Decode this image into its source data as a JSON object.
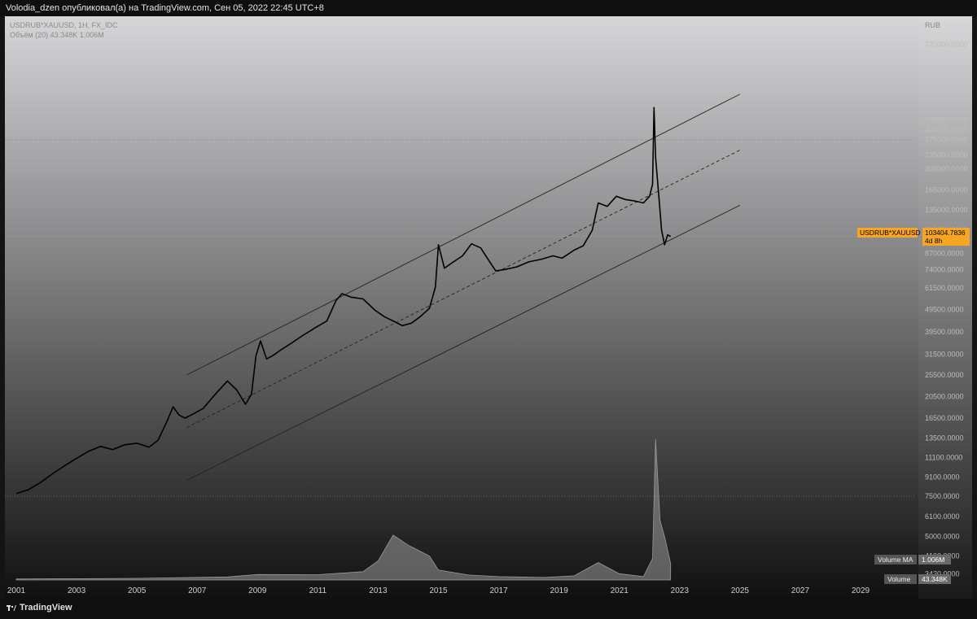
{
  "header": {
    "publisher_line": "Volodia_dzen опубликовал(а) на TradingView.com, Сен 05, 2022 22:45 UTC+8"
  },
  "footer": {
    "brand": "TradingView"
  },
  "legend": {
    "symbol_line": "USDRUB*XAUUSD, 1Н, FX_IDC",
    "volume_line": "Объём (20)  43.348K  1.006M"
  },
  "price_axis": {
    "currency": "RUB"
  },
  "price_tag": {
    "symbol": "USDRUB*XAUUSD",
    "price": "103404.7836",
    "countdown": "4d 8h"
  },
  "volume_tags": {
    "ma_label": "Volume MA",
    "ma_value": "1.006M",
    "vol_label": "Volume",
    "vol_value": "43.348K"
  },
  "colors": {
    "background_top": "#d6d6d9",
    "background_bottom": "#101010",
    "price_line": "#000000",
    "price_tag": "#f6a623",
    "volume": "#9a9a9a",
    "channel": "#222222"
  },
  "chart_data": {
    "type": "line",
    "title": "USDRUB*XAUUSD, 1Н, FX_IDC",
    "y_scale": "log",
    "ylim": [
      6000,
      800000
    ],
    "xlim": [
      2000.85,
      2030.3
    ],
    "y_ticks": [
      720000,
      335000,
      305000,
      275000,
      235000,
      205000,
      165000,
      135000,
      110000,
      87000,
      74000,
      61500,
      49500,
      39500,
      31500,
      25500,
      20500,
      16500,
      13500,
      11100,
      9100,
      7500,
      6100,
      5000,
      4100,
      3420
    ],
    "x_ticks": [
      "2001",
      "2003",
      "2005",
      "2007",
      "2009",
      "2011",
      "2013",
      "2015",
      "2017",
      "2019",
      "2021",
      "2023",
      "2025",
      "2027",
      "2029"
    ],
    "series": [
      {
        "name": "USDRUB*XAUUSD",
        "x": [
          2001.0,
          2001.4,
          2001.8,
          2002.2,
          2002.6,
          2003.0,
          2003.4,
          2003.8,
          2004.2,
          2004.6,
          2005.0,
          2005.4,
          2005.7,
          2006.0,
          2006.2,
          2006.4,
          2006.6,
          2006.9,
          2007.2,
          2007.6,
          2008.0,
          2008.3,
          2008.6,
          2008.8,
          2008.95,
          2009.1,
          2009.3,
          2009.5,
          2009.8,
          2010.1,
          2010.5,
          2010.9,
          2011.3,
          2011.6,
          2011.8,
          2012.1,
          2012.5,
          2012.9,
          2013.2,
          2013.5,
          2013.8,
          2014.1,
          2014.4,
          2014.7,
          2014.9,
          2015.0,
          2015.2,
          2015.5,
          2015.8,
          2016.1,
          2016.4,
          2016.7,
          2016.9,
          2017.2,
          2017.6,
          2018.0,
          2018.4,
          2018.8,
          2019.1,
          2019.5,
          2019.8,
          2020.1,
          2020.3,
          2020.6,
          2020.9,
          2021.2,
          2021.5,
          2021.8,
          2022.0,
          2022.1,
          2022.15,
          2022.2,
          2022.3,
          2022.4,
          2022.5,
          2022.6,
          2022.7
        ],
        "y": [
          7700,
          8000,
          8600,
          9400,
          10200,
          11000,
          11800,
          12400,
          12000,
          12600,
          12800,
          12300,
          13200,
          16000,
          18500,
          17000,
          16500,
          17300,
          18200,
          21000,
          24000,
          22000,
          19000,
          21000,
          31000,
          36000,
          30000,
          31000,
          33000,
          35000,
          38000,
          41000,
          44000,
          54000,
          58000,
          56000,
          55000,
          49000,
          46000,
          44000,
          42000,
          43000,
          46000,
          50000,
          62000,
          95000,
          75000,
          80000,
          85000,
          96000,
          92000,
          80000,
          73000,
          74000,
          76000,
          80000,
          82000,
          85000,
          83000,
          90000,
          94000,
          110000,
          145000,
          140000,
          155000,
          150000,
          148000,
          145000,
          155000,
          175000,
          380000,
          230000,
          160000,
          110000,
          95000,
          105000,
          103400
        ]
      },
      {
        "name": "Volume",
        "x": [
          2001.0,
          2005.0,
          2008.0,
          2009.0,
          2011.0,
          2012.5,
          2013.0,
          2013.5,
          2014.0,
          2014.7,
          2015.0,
          2016.0,
          2017.0,
          2018.5,
          2019.5,
          2020.3,
          2021.0,
          2021.8,
          2022.1,
          2022.2,
          2022.35,
          2022.5,
          2022.7
        ],
        "y": [
          60000,
          100000,
          180000,
          330000,
          320000,
          500000,
          1150000,
          2700000,
          2100000,
          1450000,
          600000,
          300000,
          200000,
          150000,
          250000,
          1050000,
          380000,
          200000,
          1300000,
          8500000,
          3600000,
          2600000,
          1006000
        ]
      }
    ],
    "annotations": [
      {
        "type": "parallel_channel",
        "x": [
          2006.65,
          2022.15
        ],
        "upper_y": [
          25500,
          280000
        ],
        "middle_y": [
          15000,
          160000
        ],
        "lower_y": [
          8800,
          92000
        ],
        "extends_to_x": 2025.0
      }
    ]
  }
}
